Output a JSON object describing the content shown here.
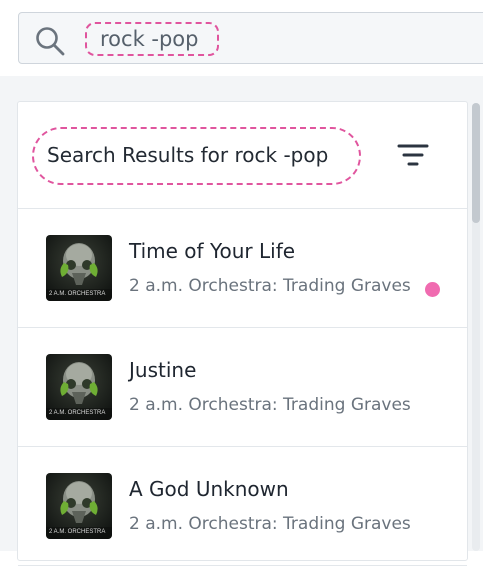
{
  "search": {
    "query": "rock -pop",
    "icon": "search-icon"
  },
  "results": {
    "title": "Search Results for rock -pop",
    "filter_icon": "filter-icon"
  },
  "tracks": [
    {
      "title": "Time of Your Life",
      "subtitle": "2 a.m. Orchestra: Trading Graves",
      "art_text": "2 A.M. ORCHESTRA",
      "has_dot": true
    },
    {
      "title": "Justine",
      "subtitle": "2 a.m. Orchestra: Trading Graves",
      "art_text": "2 A.M. ORCHESTRA",
      "has_dot": false
    },
    {
      "title": "A God Unknown",
      "subtitle": "2 a.m. Orchestra: Trading Graves",
      "art_text": "2 A.M. ORCHESTRA",
      "has_dot": false
    }
  ],
  "colors": {
    "highlight": "#e0559e",
    "dot": "#f06bb0"
  }
}
